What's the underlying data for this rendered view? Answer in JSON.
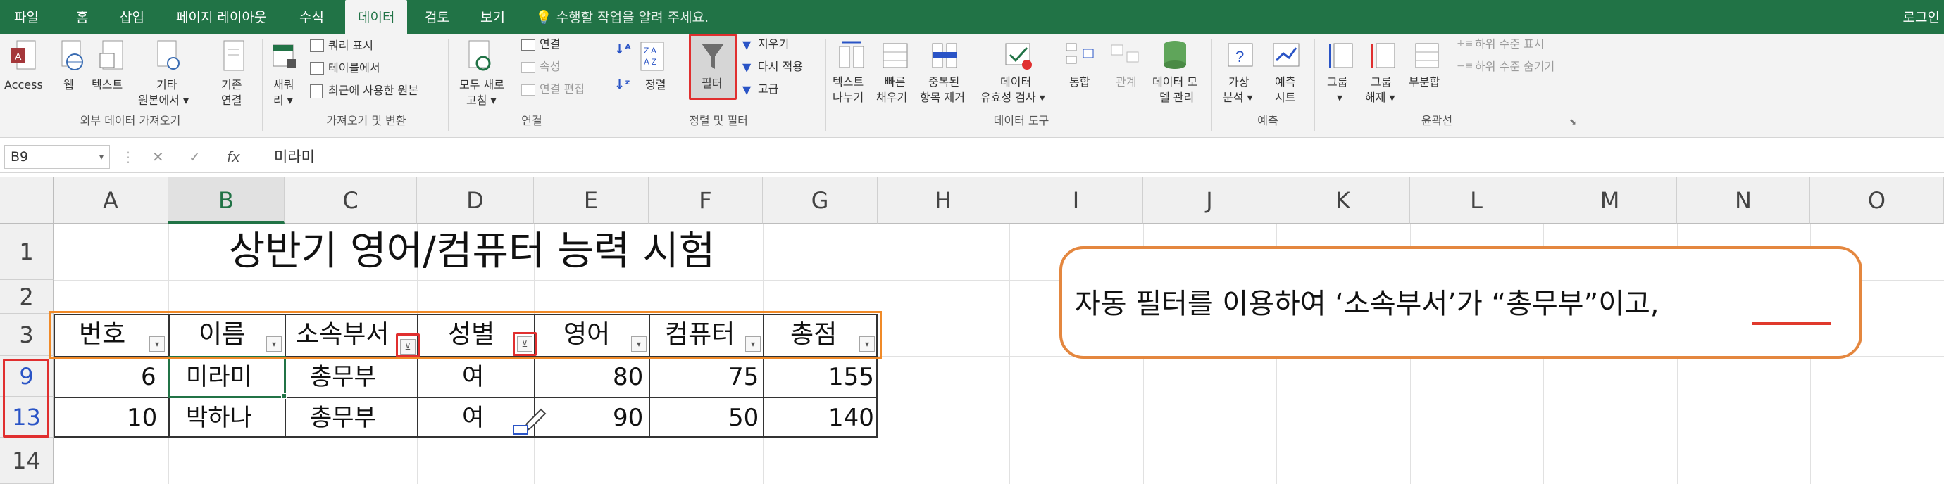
{
  "menu": {
    "tabs": [
      "파일",
      "홈",
      "삽입",
      "페이지 레이아웃",
      "수식",
      "데이터",
      "검토",
      "보기"
    ],
    "active": "데이터",
    "tell_me": "수행할 작업을 알려 주세요.",
    "login": "로그인"
  },
  "ribbon": {
    "external": {
      "buttons": [
        "Access",
        "웹",
        "텍스트",
        "기타",
        "원본에서 ▾"
      ],
      "group": "외부 데이터 가져오기"
    },
    "gettransform": {
      "new_query": "새쿼",
      "new_query2": "리 ▾",
      "show_queries": "쿼리 표시",
      "from_table": "테이블에서",
      "recent": "최근에 사용한 원본",
      "existing": "기존",
      "existing2": "연결",
      "group": "가져오기 및 변환"
    },
    "connections": {
      "refresh_all": "모두 새로",
      "refresh_all2": "고침 ▾",
      "connections": "연결",
      "properties": "속성",
      "edit_links": "연결 편집",
      "group": "연결"
    },
    "sortfilter": {
      "sort": "정렬",
      "filter": "필터",
      "clear": "지우기",
      "reapply": "다시 적용",
      "advanced": "고급",
      "group": "정렬 및 필터"
    },
    "datatools": {
      "text_to_columns": "텍스트",
      "text_to_columns2": "나누기",
      "flash_fill": "빠른",
      "flash_fill2": "채우기",
      "remove_dup": "중복된",
      "remove_dup2": "항목 제거",
      "validation": "데이터",
      "validation2": "유효성 검사 ▾",
      "consolidate": "통합",
      "relationships": "관계",
      "data_model": "데이터 모",
      "data_model2": "델 관리",
      "group": "데이터 도구"
    },
    "forecast": {
      "whatif": "가상",
      "whatif2": "분석 ▾",
      "sheet": "예측",
      "sheet2": "시트",
      "group": "예측"
    },
    "outline": {
      "group_btn": "그룹",
      "group_btn2": "▾",
      "ungroup": "그룹",
      "ungroup2": "해제 ▾",
      "subtotal": "부분합",
      "show_detail": "하위 수준 표시",
      "hide_detail": "하위 수준 숨기기",
      "group": "윤곽선"
    }
  },
  "formula": {
    "namebox": "B9",
    "cancel": "✕",
    "enter": "✓",
    "fx": "fx",
    "value": "미라미"
  },
  "columns": [
    "A",
    "B",
    "C",
    "D",
    "E",
    "F",
    "G",
    "H",
    "I",
    "J",
    "K",
    "L",
    "M",
    "N",
    "O"
  ],
  "rows": [
    "1",
    "2",
    "3",
    "9",
    "13",
    "14"
  ],
  "sheet": {
    "title": "상반기 영어/컴퓨터 능력 시험",
    "headers": [
      "번호",
      "이름",
      "소속부서",
      "성별",
      "영어",
      "컴퓨터",
      "총점"
    ],
    "data": [
      [
        "6",
        "미라미",
        "총무부",
        "여",
        "80",
        "75",
        "155"
      ],
      [
        "10",
        "박하나",
        "총무부",
        "여",
        "90",
        "50",
        "140"
      ]
    ]
  },
  "callout": {
    "text": "자동 필터를 이용하여 ‘소속부서’가 “총무부”이고,"
  },
  "colors": {
    "excel_green": "#217346",
    "highlight_red": "#e02f2f",
    "callout_orange": "#e4873f",
    "row_blue": "#2a54c6"
  }
}
